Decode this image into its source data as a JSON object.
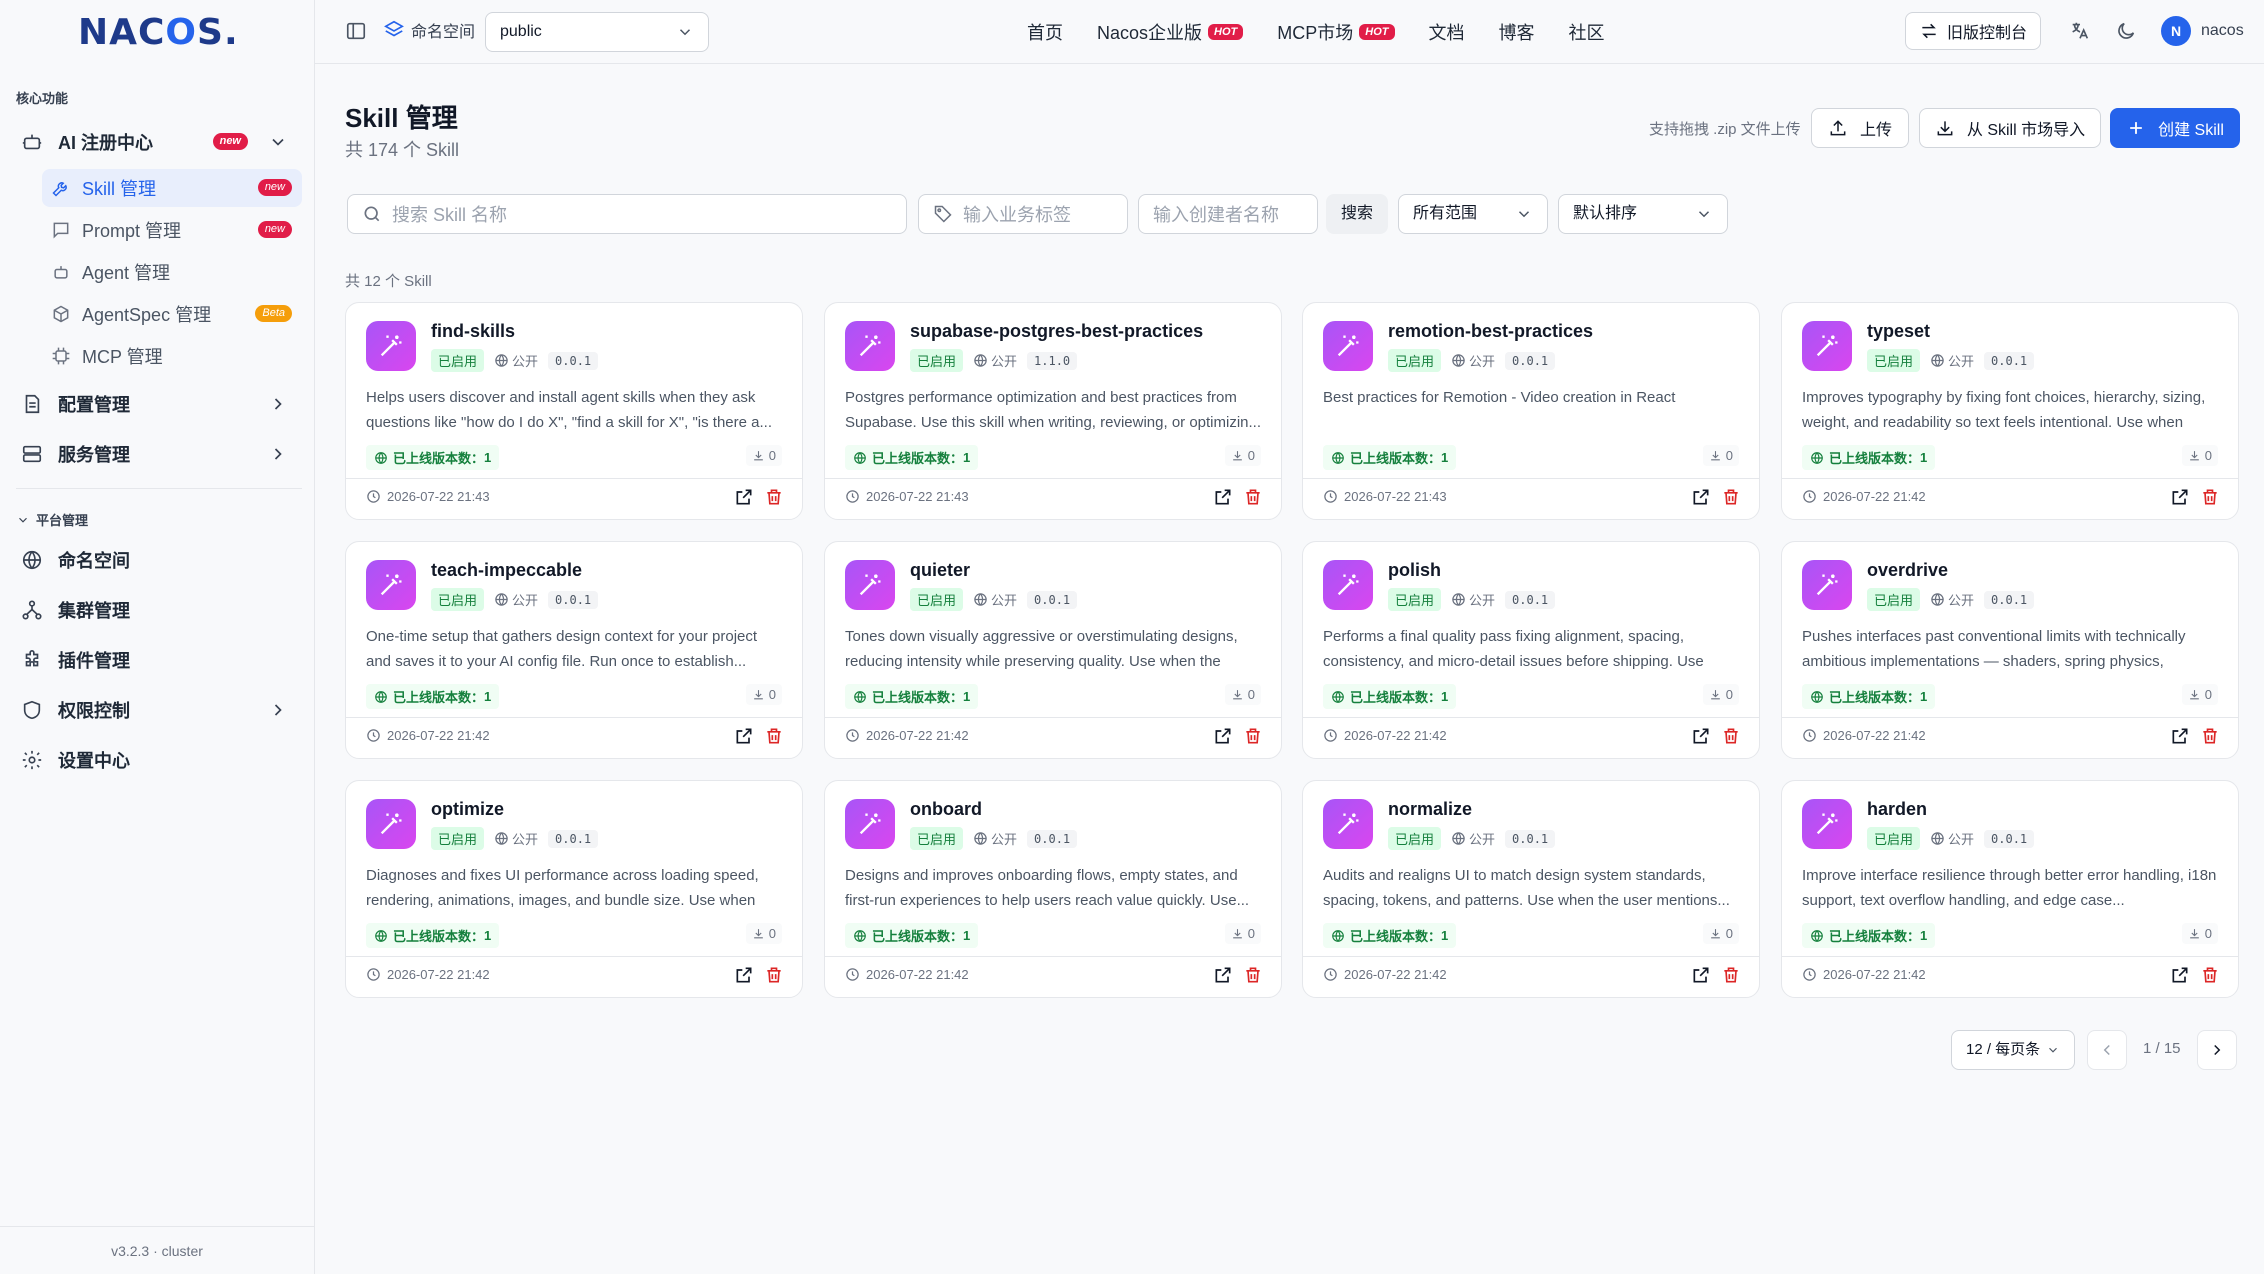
{
  "brand": {
    "logo_prefix": "NAC",
    "logo_o": "O",
    "logo_suffix": "S.",
    "accent": "#2563eb"
  },
  "sidebar": {
    "section_core": "核心功能",
    "ai_center": {
      "label": "AI 注册中心",
      "badge": "new"
    },
    "sub_items": [
      {
        "label": "Skill 管理",
        "badge": "new"
      },
      {
        "label": "Prompt 管理",
        "badge": "new"
      },
      {
        "label": "Agent 管理",
        "badge": ""
      },
      {
        "label": "AgentSpec 管理",
        "badge": "Beta"
      },
      {
        "label": "MCP 管理",
        "badge": ""
      }
    ],
    "config": "配置管理",
    "service": "服务管理",
    "section_platform": "平台管理",
    "platform_items": [
      "命名空间",
      "集群管理",
      "插件管理",
      "权限控制",
      "设置中心"
    ],
    "version": "v3.2.3 · cluster"
  },
  "header": {
    "namespace_label": "命名空间",
    "namespace_value": "public",
    "nav": [
      {
        "label": "首页",
        "hot": ""
      },
      {
        "label": "Nacos企业版",
        "hot": "HOT"
      },
      {
        "label": "MCP市场",
        "hot": "HOT"
      },
      {
        "label": "文档",
        "hot": ""
      },
      {
        "label": "博客",
        "hot": ""
      },
      {
        "label": "社区",
        "hot": ""
      }
    ],
    "legacy_console": "旧版控制台",
    "avatar_letter": "N",
    "username": "nacos"
  },
  "page": {
    "title": "Skill 管理",
    "subtitle": "共 174 个 Skill",
    "upload_hint": "支持拖拽 .zip 文件上传",
    "upload_btn": "上传",
    "import_btn": "从 Skill 市场导入",
    "create_btn": "创建 Skill",
    "search_placeholder": "搜索 Skill 名称",
    "tag_placeholder": "输入业务标签",
    "creator_placeholder": "输入创建者名称",
    "search_btn": "搜索",
    "scope_select": "所有范围",
    "sort_select": "默认排序",
    "result_count": "共 12 个 Skill"
  },
  "card_labels": {
    "enabled": "已启用",
    "public": "公开",
    "online_prefix": "已上线版本数："
  },
  "skills": [
    {
      "name": "find-skills",
      "version": "0.0.1",
      "desc": "Helps users discover and install agent skills when they ask questions like \"how do I do X\", \"find a skill for X\", \"is there a...",
      "online": "1",
      "downloads": "0",
      "time": "2026-07-22 21:43"
    },
    {
      "name": "supabase-postgres-best-practices",
      "version": "1.1.0",
      "desc": "Postgres performance optimization and best practices from Supabase. Use this skill when writing, reviewing, or optimizin...",
      "online": "1",
      "downloads": "0",
      "time": "2026-07-22 21:43"
    },
    {
      "name": "remotion-best-practices",
      "version": "0.0.1",
      "desc": "Best practices for Remotion - Video creation in React",
      "online": "1",
      "downloads": "0",
      "time": "2026-07-22 21:43"
    },
    {
      "name": "typeset",
      "version": "0.0.1",
      "desc": "Improves typography by fixing font choices, hierarchy, sizing, weight, and readability so text feels intentional. Use when the...",
      "online": "1",
      "downloads": "0",
      "time": "2026-07-22 21:42"
    },
    {
      "name": "teach-impeccable",
      "version": "0.0.1",
      "desc": "One-time setup that gathers design context for your project and saves it to your AI config file. Run once to establish...",
      "online": "1",
      "downloads": "0",
      "time": "2026-07-22 21:42"
    },
    {
      "name": "quieter",
      "version": "0.0.1",
      "desc": "Tones down visually aggressive or overstimulating designs, reducing intensity while preserving quality. Use when the use...",
      "online": "1",
      "downloads": "0",
      "time": "2026-07-22 21:42"
    },
    {
      "name": "polish",
      "version": "0.0.1",
      "desc": "Performs a final quality pass fixing alignment, spacing, consistency, and micro-detail issues before shipping. Use wh...",
      "online": "1",
      "downloads": "0",
      "time": "2026-07-22 21:42"
    },
    {
      "name": "overdrive",
      "version": "0.0.1",
      "desc": "Pushes interfaces past conventional limits with technically ambitious implementations — shaders, spring physics, scroll-...",
      "online": "1",
      "downloads": "0",
      "time": "2026-07-22 21:42"
    },
    {
      "name": "optimize",
      "version": "0.0.1",
      "desc": "Diagnoses and fixes UI performance across loading speed, rendering, animations, images, and bundle size. Use when th...",
      "online": "1",
      "downloads": "0",
      "time": "2026-07-22 21:42"
    },
    {
      "name": "onboard",
      "version": "0.0.1",
      "desc": "Designs and improves onboarding flows, empty states, and first-run experiences to help users reach value quickly. Use...",
      "online": "1",
      "downloads": "0",
      "time": "2026-07-22 21:42"
    },
    {
      "name": "normalize",
      "version": "0.0.1",
      "desc": "Audits and realigns UI to match design system standards, spacing, tokens, and patterns. Use when the user mentions...",
      "online": "1",
      "downloads": "0",
      "time": "2026-07-22 21:42"
    },
    {
      "name": "harden",
      "version": "0.0.1",
      "desc": "Improve interface resilience through better error handling, i18n support, text overflow handling, and edge case...",
      "online": "1",
      "downloads": "0",
      "time": "2026-07-22 21:42"
    }
  ],
  "pager": {
    "page_size": "12 / 每页条",
    "page_info": "1 / 15"
  }
}
